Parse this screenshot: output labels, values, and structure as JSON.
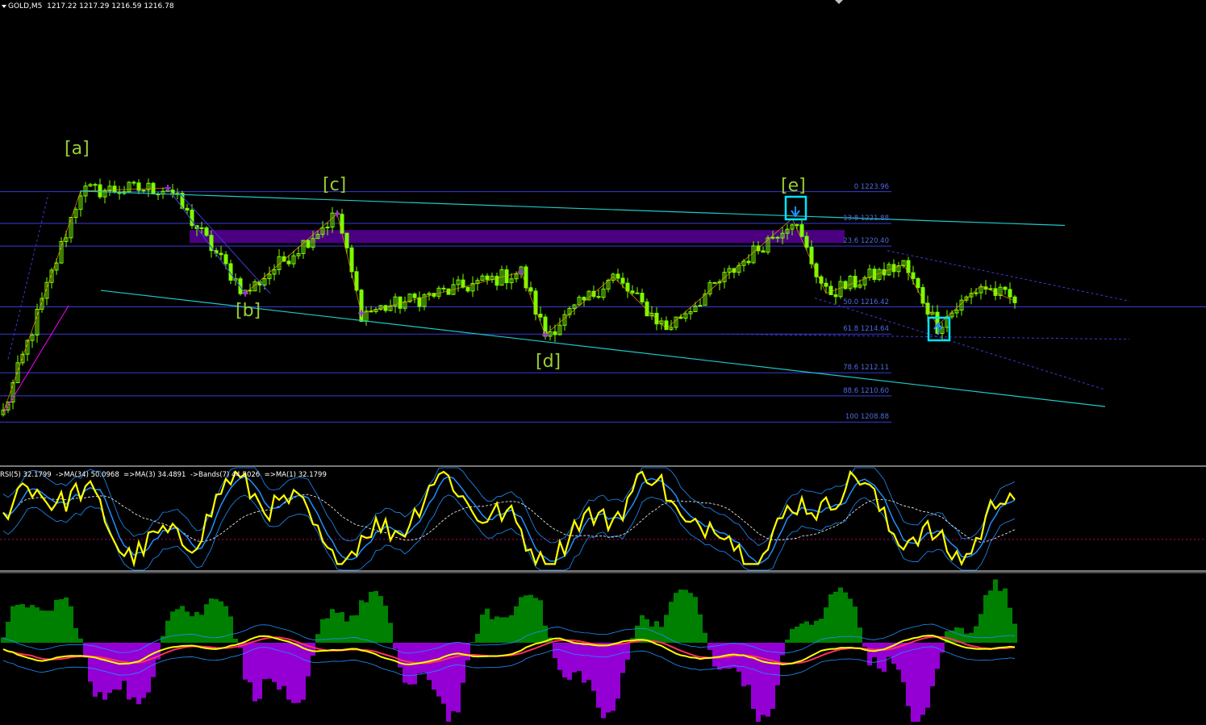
{
  "header": {
    "symbol": "GOLD,M5",
    "ohlc": "1217.22 1217.29 1216.59 1216.78"
  },
  "rsi_header": "RSI(5) 32.1799  ->MA(34) 50.0968  =>MA(3) 34.4891  ->Bands(7) 44.5026  =>MA(1) 32.1799",
  "wave_labels": [
    {
      "label": "[a]"
    },
    {
      "label": "[b]"
    },
    {
      "label": "[c]"
    },
    {
      "label": "[d]"
    },
    {
      "label": "[e]"
    }
  ],
  "fib_levels": [
    {
      "label": "0 1223.96",
      "price": 1223.96
    },
    {
      "label": "13.8 1221.88",
      "price": 1221.88
    },
    {
      "label": "23.6 1220.40",
      "price": 1220.4
    },
    {
      "label": "50.0 1216.42",
      "price": 1216.42
    },
    {
      "label": "61.8 1214.64",
      "price": 1214.64
    },
    {
      "label": "78.6 1212.11",
      "price": 1212.11
    },
    {
      "label": "88.6 1210.60",
      "price": 1210.6
    },
    {
      "label": "100 1208.88",
      "price": 1208.88
    }
  ],
  "colors": {
    "background": "#000000",
    "candle": "#7cfc00",
    "wave_label": "#9acd32",
    "fib_line": "#3a3ad8",
    "fib_label": "#4e6be0",
    "trendline": "#20c8c8",
    "zone": "#4b0082",
    "marker": "#9932cc",
    "highlight_box": "#00e5ff",
    "rsi_line": "#ffff00",
    "rsi_ma": "#1e90ff",
    "hist_pos": "#008000",
    "hist_neg": "#9400d3",
    "ma_yellow": "#ffff00",
    "ma_red": "#ff3060",
    "band": "#1e90ff"
  },
  "chart_data": [
    {
      "type": "candlestick",
      "title": "GOLD,M5",
      "ylim": [
        1206.0,
        1236.5
      ],
      "x_count": 210,
      "key_points": [
        {
          "x": 0,
          "y": 1209.5
        },
        {
          "x": 16,
          "y": 1224.0
        },
        {
          "x": 34,
          "y": 1224.2
        },
        {
          "x": 50,
          "y": 1217.3
        },
        {
          "x": 69,
          "y": 1222.5
        },
        {
          "x": 74,
          "y": 1216.0
        },
        {
          "x": 107,
          "y": 1218.7
        },
        {
          "x": 112,
          "y": 1214.6
        },
        {
          "x": 126,
          "y": 1218.4
        },
        {
          "x": 137,
          "y": 1215.0
        },
        {
          "x": 163,
          "y": 1222.2
        },
        {
          "x": 170,
          "y": 1217.3
        },
        {
          "x": 186,
          "y": 1219.2
        },
        {
          "x": 193,
          "y": 1215.2
        },
        {
          "x": 202,
          "y": 1217.8
        },
        {
          "x": 209,
          "y": 1216.8
        }
      ],
      "fib_levels": [
        1223.96,
        1221.88,
        1220.4,
        1216.42,
        1214.64,
        1212.11,
        1210.6,
        1208.88
      ]
    },
    {
      "type": "line",
      "title": "RSI(5)",
      "ylim": [
        0,
        100
      ],
      "series": [
        {
          "name": "RSI(5)",
          "last": 32.1799
        },
        {
          "name": "MA(34)",
          "last": 50.0968
        },
        {
          "name": "MA(3)",
          "last": 34.4891
        },
        {
          "name": "Bands(7)",
          "last": 44.5026
        },
        {
          "name": "MA(1)",
          "last": 32.1799
        }
      ]
    },
    {
      "type": "bar",
      "ylim": [
        -1,
        1
      ],
      "series": []
    }
  ]
}
